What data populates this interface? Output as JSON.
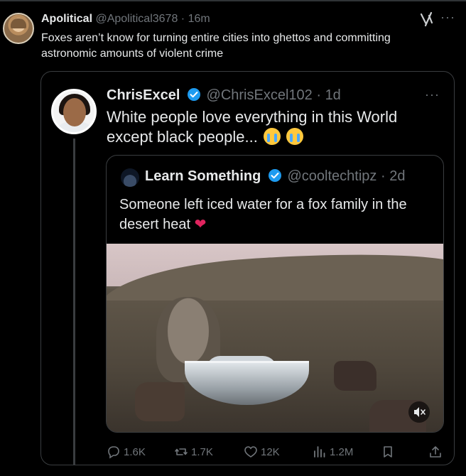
{
  "outer_tweet": {
    "author_name": "Apolitical",
    "handle": "@Apolitical3678",
    "separator": "·",
    "time": "16m",
    "text": "Foxes aren’t know for turning entire cities into ghettos and committing astronomic amounts of violent crime",
    "more_label": "···"
  },
  "quoted_tweet": {
    "author_name": "ChrisExcel",
    "handle": "@ChrisExcel102",
    "separator": "·",
    "time": "1d",
    "text": "White people love everything in this World except black people...",
    "more_label": "···"
  },
  "nested_quote": {
    "author_name": "Learn Something",
    "handle": "@cooltechtipz",
    "separator": "·",
    "time": "2d",
    "text": "Someone left iced water for a fox family in the desert heat"
  },
  "actions": {
    "replies": "1.6K",
    "reposts": "1.7K",
    "likes": "12K",
    "views": "1.2M"
  },
  "colors": {
    "background": "#000000",
    "text": "#e7e9ea",
    "muted": "#71767b",
    "border": "#2f3336",
    "verified": "#1d9bf0"
  },
  "icons": [
    "grok-icon",
    "more-icon",
    "verified-badge-icon",
    "mute-icon",
    "reply-icon",
    "repost-icon",
    "like-icon",
    "views-icon",
    "bookmark-icon",
    "share-icon",
    "sob-emoji-icon",
    "heart-emoji-icon"
  ]
}
